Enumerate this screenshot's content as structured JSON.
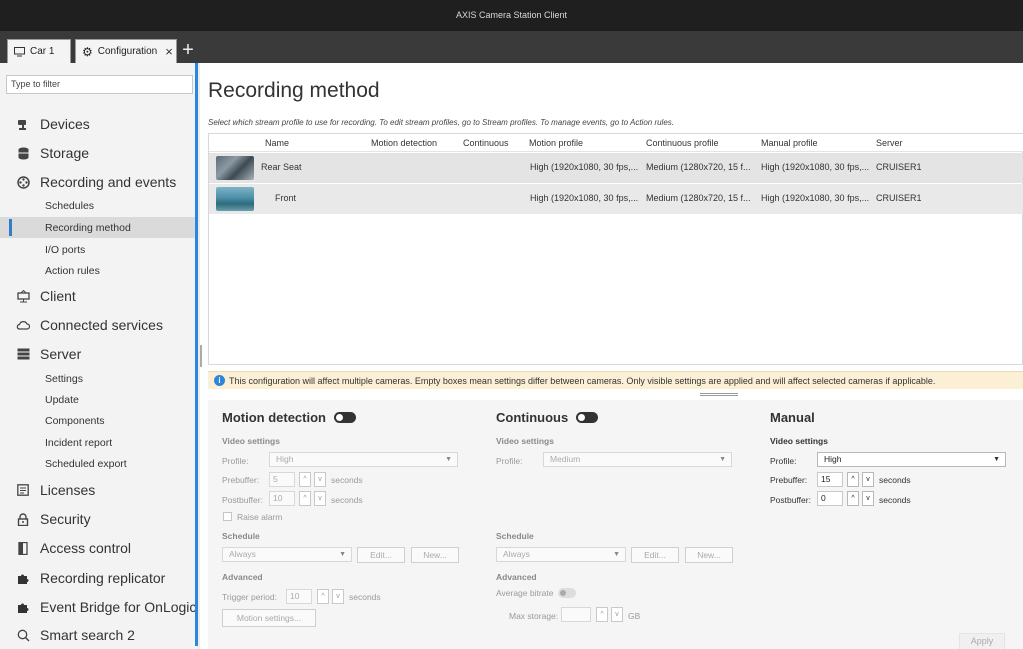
{
  "app": {
    "title": "AXIS Camera Station Client"
  },
  "tabs": [
    {
      "label": "Car 1",
      "icon": "monitor-icon"
    },
    {
      "label": "Configuration",
      "icon": "gear-icon",
      "close": "×"
    }
  ],
  "tab_add": "+",
  "sidebar": {
    "filter_placeholder": "Type to filter",
    "items": [
      {
        "label": "Devices",
        "icon": "camera-icon"
      },
      {
        "label": "Storage",
        "icon": "database-icon"
      },
      {
        "label": "Recording and events",
        "icon": "film-reel-icon"
      },
      {
        "label": "Schedules"
      },
      {
        "label": "Recording method",
        "active": true
      },
      {
        "label": "I/O ports"
      },
      {
        "label": "Action rules"
      },
      {
        "label": "Client",
        "icon": "client-icon"
      },
      {
        "label": "Connected services",
        "icon": "cloud-icon"
      },
      {
        "label": "Server",
        "icon": "server-icon"
      },
      {
        "label": "Settings"
      },
      {
        "label": "Update"
      },
      {
        "label": "Components"
      },
      {
        "label": "Incident report"
      },
      {
        "label": "Scheduled export"
      },
      {
        "label": "Licenses",
        "icon": "license-icon"
      },
      {
        "label": "Security",
        "icon": "lock-icon"
      },
      {
        "label": "Access control",
        "icon": "door-icon"
      },
      {
        "label": "Recording replicator",
        "icon": "puzzle-icon"
      },
      {
        "label": "Event Bridge for OnLogic",
        "icon": "puzzle-icon"
      },
      {
        "label": "Smart search 2",
        "icon": "search-icon"
      }
    ]
  },
  "main": {
    "title": "Recording method",
    "subtitle": "Select which stream profile to use for recording. To edit stream profiles, go to Stream profiles. To manage events, go to Action rules.",
    "columns": [
      "Name",
      "Motion detection",
      "Continuous",
      "Motion profile",
      "Continuous profile",
      "Manual profile",
      "Server"
    ],
    "rows": [
      {
        "name": "Rear Seat",
        "motion_detection": "",
        "continuous": "",
        "motion_profile": "High (1920x1080, 30 fps,...",
        "continuous_profile": "Medium (1280x720, 15 f...",
        "manual_profile": "High (1920x1080, 30 fps,...",
        "server": "CRUISER1"
      },
      {
        "name": "Front",
        "motion_detection": "",
        "continuous": "",
        "motion_profile": "High (1920x1080, 30 fps,...",
        "continuous_profile": "Medium (1280x720, 15 f...",
        "manual_profile": "High (1920x1080, 30 fps,...",
        "server": "CRUISER1"
      }
    ],
    "info": "This configuration will affect multiple cameras. Empty boxes mean settings differ between cameras. Only visible settings are applied and will affect selected cameras if applicable."
  },
  "motion": {
    "title": "Motion detection",
    "video_settings": "Video settings",
    "profile_label": "Profile:",
    "profile_value": "High",
    "prebuffer_label": "Prebuffer:",
    "prebuffer_value": "5",
    "postbuffer_label": "Postbuffer:",
    "postbuffer_value": "10",
    "seconds": "seconds",
    "raise_alarm": "Raise alarm",
    "schedule": "Schedule",
    "schedule_value": "Always",
    "edit": "Edit...",
    "new": "New...",
    "advanced": "Advanced",
    "trigger_label": "Trigger period:",
    "trigger_value": "10",
    "motion_settings": "Motion settings..."
  },
  "continuous": {
    "title": "Continuous",
    "video_settings": "Video settings",
    "profile_label": "Profile:",
    "profile_value": "Medium",
    "schedule": "Schedule",
    "schedule_value": "Always",
    "edit": "Edit...",
    "new": "New...",
    "advanced": "Advanced",
    "average_bitrate": "Average bitrate",
    "max_storage_label": "Max storage:",
    "max_storage_unit": "GB"
  },
  "manual": {
    "title": "Manual",
    "video_settings": "Video settings",
    "profile_label": "Profile:",
    "profile_value": "High",
    "prebuffer_label": "Prebuffer:",
    "prebuffer_value": "15",
    "postbuffer_label": "Postbuffer:",
    "postbuffer_value": "0",
    "seconds": "seconds"
  },
  "apply": "Apply"
}
